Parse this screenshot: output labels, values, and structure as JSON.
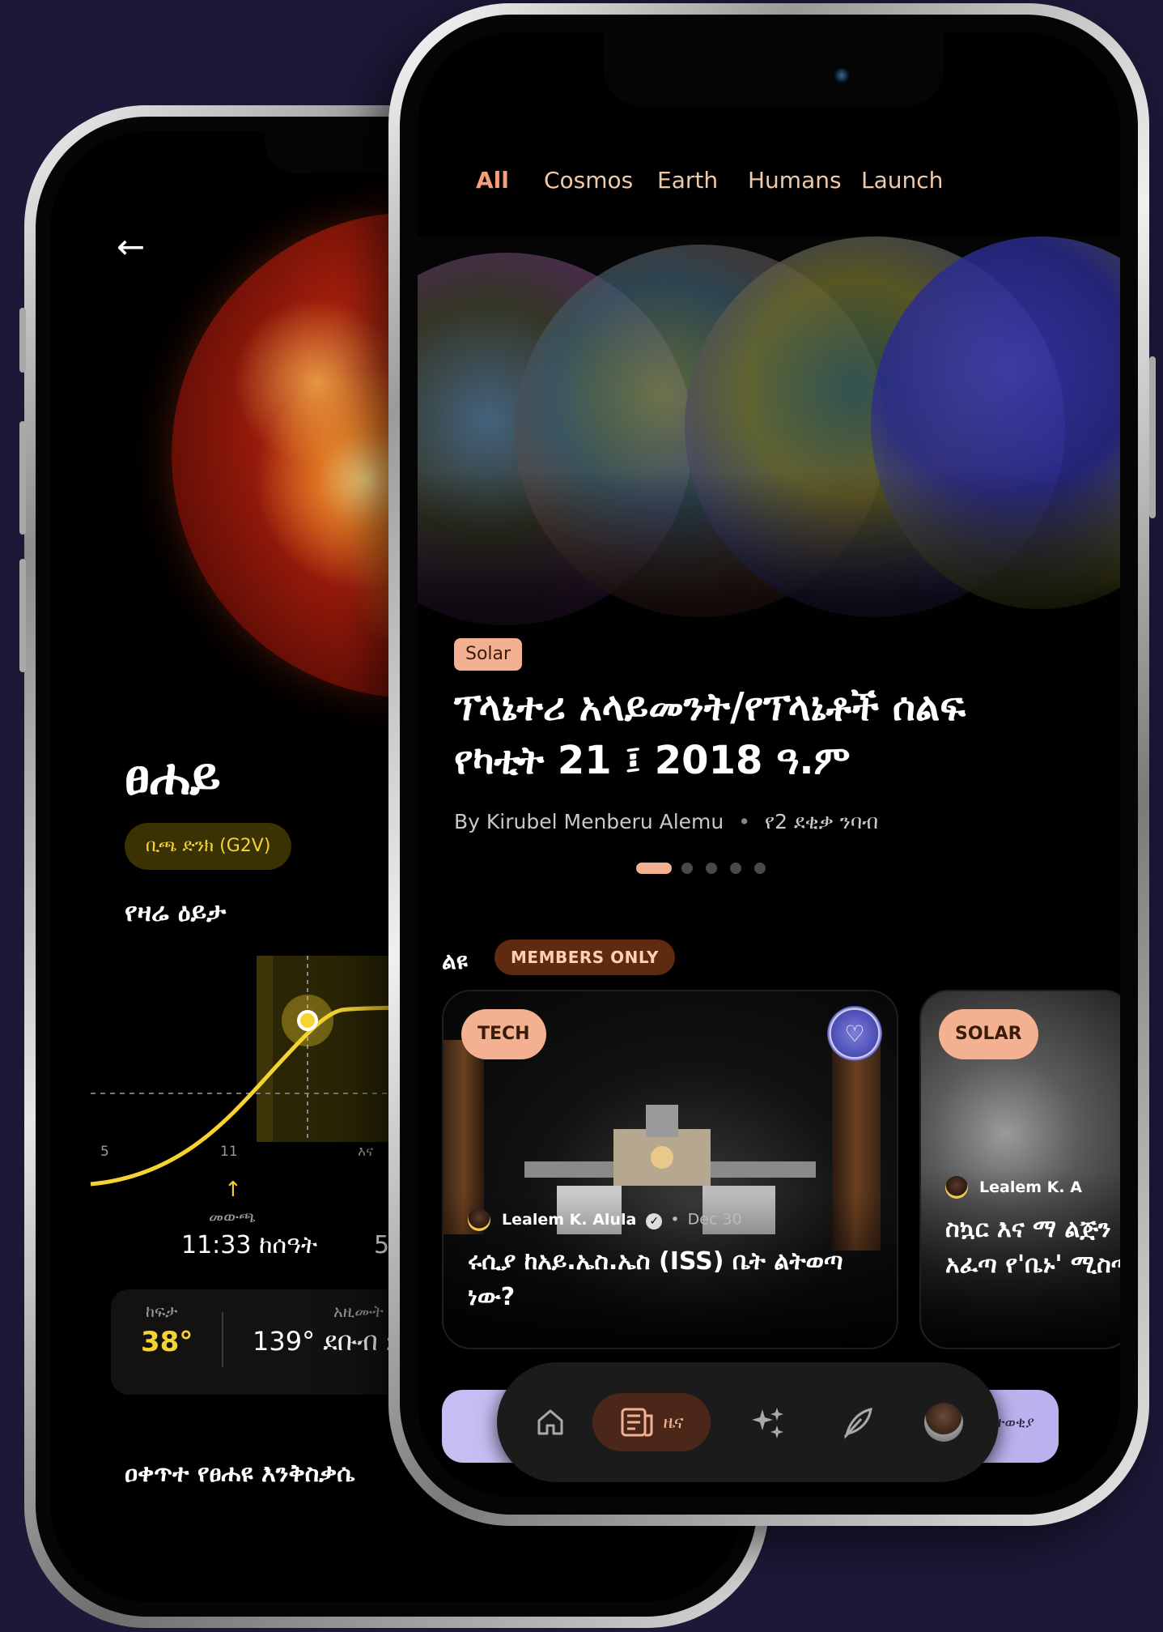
{
  "back_phone": {
    "sun_name": "ፀሐይ",
    "star_class": "ቢጫ ድንክ (G2V)",
    "todays_view_title": "የዛሬ ዕይታ",
    "chart_ticks": [
      "5",
      "11",
      "እና"
    ],
    "sunrise_label": "መውጫ",
    "sunrise_time": "11:33 ከሰዓት",
    "sunset_label": "እ",
    "sunset_time": "5:1",
    "altitude_label": "ከፍታ",
    "altitude_value": "38°",
    "azimuth_label": "አዚሙት",
    "azimuth_value": "139° ደቡብ ምስራ",
    "movement_title": "ዐቀጥተ የፀሐዩ እንቅስቃሴ"
  },
  "front_phone": {
    "status_left": "",
    "status_right": "",
    "tabs": [
      {
        "label": "All",
        "active": true
      },
      {
        "label": "Cosmos",
        "active": false
      },
      {
        "label": "Earth",
        "active": false
      },
      {
        "label": "Humans",
        "active": false
      },
      {
        "label": "Launch",
        "active": false
      }
    ],
    "hero": {
      "tag": "Solar",
      "title": "ፕላኔተሪ አላይመንት/የፕላኔቶች ሰልፍ የካቲት 21 ፤ 2018 ዓ.ም",
      "author": "By Kirubel Menberu Alemu",
      "read_time": "የ2 ደቂቃ ንባብ",
      "carousel_count": 5,
      "carousel_active": 0
    },
    "featured": {
      "label": "ልዩ",
      "members_chip": "MEMBERS ONLY",
      "cards": [
        {
          "tag": "TECH",
          "author": "Lealem K. Alula",
          "date": "Dec 30",
          "title": "ሩሲያ ከአይ.ኤስ.ኤስ (ISS) ቤት ልትወጣ ነው?"
        },
        {
          "tag": "SOLAR",
          "author": "Lealem K. A",
          "title": "ስኳር እና ማ ልጅን አፈጣ የ'ቤኑ' ሚስጣ"
        }
      ]
    },
    "bottom_strip_text": "ተወቂያ",
    "nav": {
      "items": [
        "home-icon",
        "news-icon",
        "sparkles-icon",
        "feather-icon",
        "profile-avatar"
      ],
      "active_label": "ዜና"
    }
  },
  "colors": {
    "background": "#1d1838",
    "accent_peach": "#f4b192",
    "accent_yellow": "#f5d331",
    "members_chip_bg": "#5e2a10"
  }
}
